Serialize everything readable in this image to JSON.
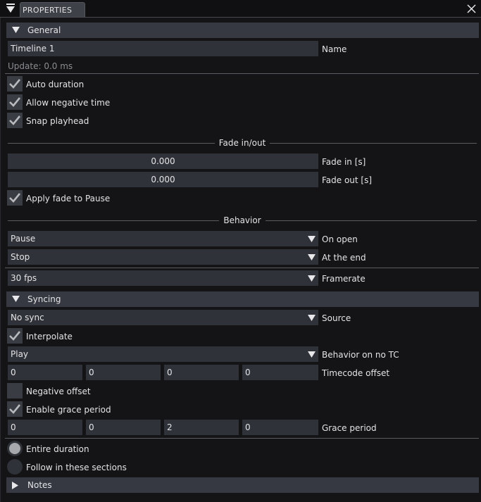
{
  "window": {
    "tab_title": "PROPERTIES"
  },
  "icons": {
    "menu": "menu-triangle-icon",
    "close": "close-icon",
    "expanded": "triangle-down-icon",
    "collapsed": "triangle-right-icon",
    "dropdown": "dropdown-arrow-icon",
    "check": "checkmark-icon"
  },
  "colors": {
    "background": "#141416",
    "section_header": "#363942",
    "field": "#30323a",
    "checkbox": "#3a3c44",
    "separator": "#5a5c62",
    "text": "#e4e4e6",
    "muted_text": "#8a8c92"
  },
  "general": {
    "header": "General",
    "name_value": "Timeline 1",
    "name_label": "Name",
    "update_text": "Update: 0.0 ms",
    "auto_duration": "Auto duration",
    "allow_negative_time": "Allow negative time",
    "snap_playhead": "Snap playhead",
    "fade_group": "Fade in/out",
    "fade_in_value": "0.000",
    "fade_in_label": "Fade in [s]",
    "fade_out_value": "0.000",
    "fade_out_label": "Fade out [s]",
    "apply_fade_to_pause": "Apply fade to Pause",
    "behavior_group": "Behavior",
    "on_open_value": "Pause",
    "on_open_label": "On open",
    "at_end_value": "Stop",
    "at_end_label": "At the end",
    "framerate_value": "30 fps",
    "framerate_label": "Framerate"
  },
  "syncing": {
    "header": "Syncing",
    "source_value": "No sync",
    "source_label": "Source",
    "interpolate": "Interpolate",
    "no_tc_value": "Play",
    "no_tc_label": "Behavior on no TC",
    "timecode_offset": [
      "0",
      "0",
      "0",
      "0"
    ],
    "timecode_offset_label": "Timecode offset",
    "negative_offset": "Negative offset",
    "enable_grace_period": "Enable grace period",
    "grace_period": [
      "0",
      "0",
      "2",
      "0"
    ],
    "grace_period_label": "Grace period",
    "entire_duration": "Entire duration",
    "follow_sections": "Follow in these sections"
  },
  "notes": {
    "header": "Notes"
  }
}
